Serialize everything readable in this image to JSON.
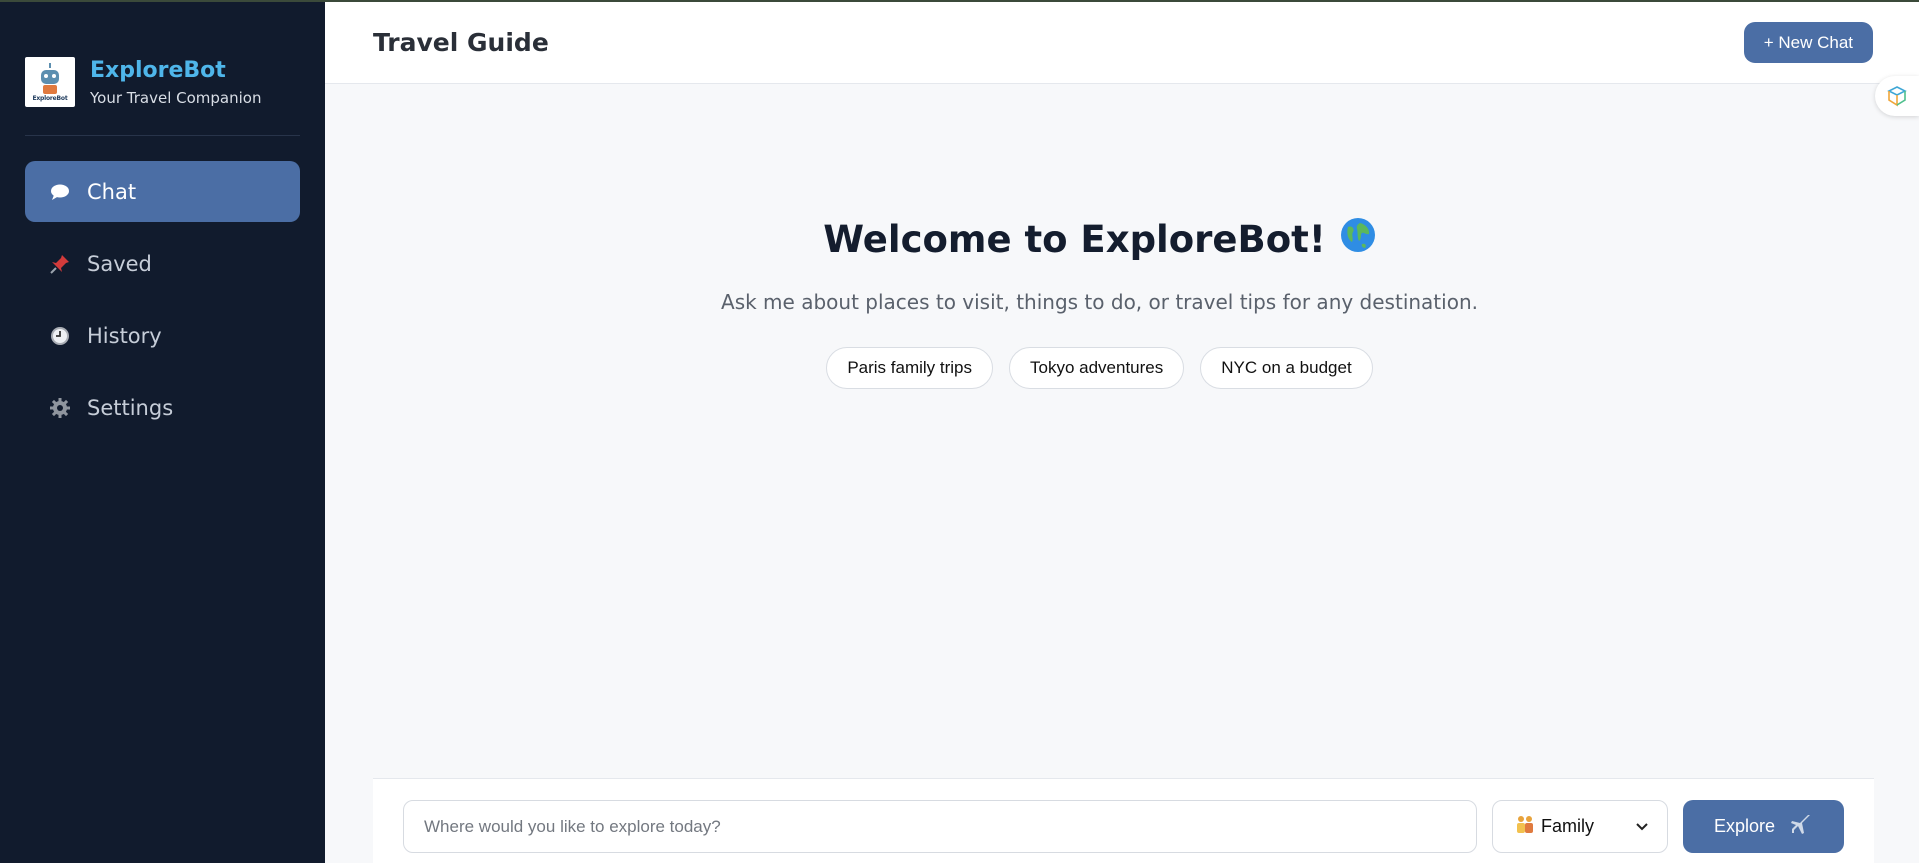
{
  "sidebar": {
    "brand_name": "ExploreBot",
    "brand_tagline": "Your Travel Companion",
    "logo_text": "ExploreBot",
    "items": [
      {
        "label": "Chat",
        "icon": "speech-bubble-icon",
        "active": true
      },
      {
        "label": "Saved",
        "icon": "pushpin-icon",
        "active": false
      },
      {
        "label": "History",
        "icon": "clock-icon",
        "active": false
      },
      {
        "label": "Settings",
        "icon": "gear-icon",
        "active": false
      }
    ]
  },
  "header": {
    "title": "Travel Guide",
    "new_chat_label": "+ New Chat"
  },
  "welcome": {
    "title": "Welcome to ExploreBot!",
    "title_icon": "globe-icon",
    "subtitle": "Ask me about places to visit, things to do, or travel tips for any destination."
  },
  "suggestions": [
    "Paris family trips",
    "Tokyo adventures",
    "NYC on a budget"
  ],
  "composer": {
    "placeholder": "Where would you like to explore today?",
    "value": "",
    "mode_selected": "Family",
    "mode_icon": "family-icon",
    "submit_label": "Explore",
    "submit_icon": "airplane-icon"
  },
  "colors": {
    "sidebar_bg": "#111b2d",
    "accent": "#4b6ea5",
    "brand": "#4fb6ea",
    "main_bg": "#f7f8fa"
  }
}
